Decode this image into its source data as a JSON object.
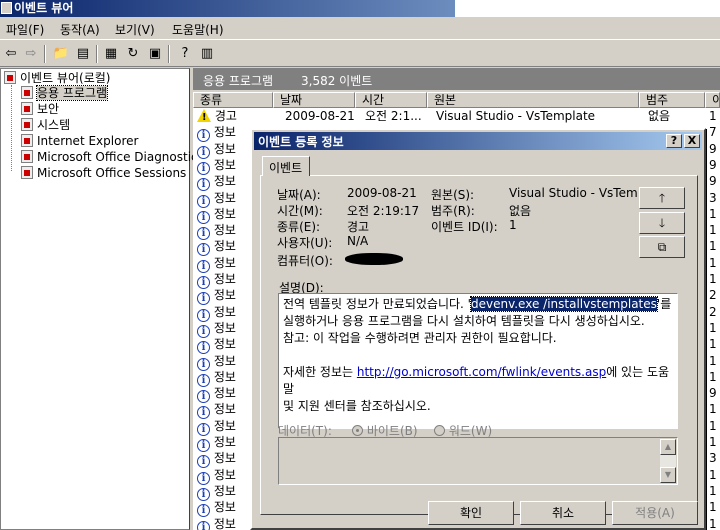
{
  "window": {
    "title": "이벤트 뷰어"
  },
  "menu": [
    "파일(F)",
    "동작(A)",
    "보기(V)",
    "도움말(H)"
  ],
  "toolbar_icons": [
    "back-arrow-icon",
    "forward-arrow-icon",
    "up-folder-icon",
    "show-hide-tree-icon",
    "properties-icon",
    "refresh-icon",
    "export-icon",
    "help-icon",
    "console-icon"
  ],
  "tree": {
    "root": "이벤트 뷰어(로컬)",
    "items": [
      "응용 프로그램",
      "보안",
      "시스템",
      "Internet Explorer",
      "Microsoft Office Diagnostic:",
      "Microsoft Office Sessions"
    ]
  },
  "pane": {
    "title": "응용 프로그램",
    "count": "3,582 이벤트"
  },
  "columns": [
    "종류",
    "날짜",
    "시간",
    "원본",
    "범주",
    "이"
  ],
  "rows": [
    {
      "type": "경고",
      "date": "2009-08-21",
      "time": "오전 2:1...",
      "source": "Visual Studio - VsTemplate",
      "category": "없음",
      "id": "1"
    },
    {
      "type": "정보",
      "date": "",
      "time": "",
      "source": "",
      "category": "",
      "id": "7"
    },
    {
      "type": "정보",
      "date": "",
      "time": "",
      "source": "",
      "category": "",
      "id": "9"
    },
    {
      "type": "정보",
      "date": "",
      "time": "",
      "source": "",
      "category": "",
      "id": "9"
    },
    {
      "type": "정보",
      "date": "",
      "time": "",
      "source": "",
      "category": "",
      "id": "9"
    },
    {
      "type": "정보",
      "date": "",
      "time": "",
      "source": "",
      "category": "",
      "id": "3"
    },
    {
      "type": "정보",
      "date": "",
      "time": "",
      "source": "",
      "category": "",
      "id": "1"
    },
    {
      "type": "정보",
      "date": "",
      "time": "",
      "source": "",
      "category": "",
      "id": "1"
    },
    {
      "type": "정보",
      "date": "",
      "time": "",
      "source": "",
      "category": "",
      "id": "1"
    },
    {
      "type": "정보",
      "date": "",
      "time": "",
      "source": "",
      "category": "",
      "id": "1"
    },
    {
      "type": "정보",
      "date": "",
      "time": "",
      "source": "",
      "category": "",
      "id": "1"
    },
    {
      "type": "정보",
      "date": "",
      "time": "",
      "source": "",
      "category": "",
      "id": "2"
    },
    {
      "type": "정보",
      "date": "",
      "time": "",
      "source": "",
      "category": "",
      "id": "2"
    },
    {
      "type": "정보",
      "date": "",
      "time": "",
      "source": "",
      "category": "",
      "id": "1"
    },
    {
      "type": "정보",
      "date": "",
      "time": "",
      "source": "",
      "category": "",
      "id": "1"
    },
    {
      "type": "정보",
      "date": "",
      "time": "",
      "source": "",
      "category": "",
      "id": "1"
    },
    {
      "type": "정보",
      "date": "",
      "time": "",
      "source": "",
      "category": "",
      "id": "1"
    },
    {
      "type": "정보",
      "date": "",
      "time": "",
      "source": "",
      "category": "",
      "id": "9"
    },
    {
      "type": "정보",
      "date": "",
      "time": "",
      "source": "",
      "category": "",
      "id": "1"
    },
    {
      "type": "정보",
      "date": "",
      "time": "",
      "source": "",
      "category": "",
      "id": "1"
    },
    {
      "type": "정보",
      "date": "",
      "time": "",
      "source": "",
      "category": "",
      "id": "1"
    },
    {
      "type": "정보",
      "date": "",
      "time": "",
      "source": "",
      "category": "",
      "id": "3"
    },
    {
      "type": "정보",
      "date": "",
      "time": "",
      "source": "",
      "category": "",
      "id": "1"
    },
    {
      "type": "정보",
      "date": "",
      "time": "",
      "source": "",
      "category": "",
      "id": "1"
    },
    {
      "type": "정보",
      "date": "",
      "time": "",
      "source": "",
      "category": "",
      "id": "1"
    },
    {
      "type": "정보",
      "date": "",
      "time": "",
      "source": "",
      "category": "",
      "id": "1"
    }
  ],
  "dialog": {
    "title": "이벤트 등록 정보",
    "tab": "이벤트",
    "help_btn": "?",
    "close_btn": "X",
    "date_label": "날짜(A):",
    "date_value": "2009-08-21",
    "time_label": "시간(M):",
    "time_value": "오전 2:19:17",
    "type_label": "종류(E):",
    "type_value": "경고",
    "user_label": "사용자(U):",
    "user_value": "N/A",
    "computer_label": "컴퓨터(O):",
    "source_label": "원본(S):",
    "source_value": "Visual Studio - VsTem",
    "category_label": "범주(R):",
    "category_value": "없음",
    "eventid_label": "이벤트 ID(I):",
    "eventid_value": "1",
    "desc_label": "설명(D):",
    "desc_line1_pre": "전역 템플릿 정보가 만료되었습니다. '",
    "desc_line1_hl": "devenv.exe /installvstemplates",
    "desc_line1_post": "'를",
    "desc_line2": "실행하거나 응용 프로그램을 다시 설치하여 템플릿을 다시 생성하십시오.",
    "desc_line3": "참고: 이 작업을 수행하려면 관리자 권한이 필요합니다.",
    "desc_line4_pre": "자세한 정보는 ",
    "desc_link": "http://go.microsoft.com/fwlink/events.asp",
    "desc_line4_post": "에 있는 도움말",
    "desc_line5": "및 지원 센터를 참조하십시오.",
    "data_label": "데이터(T):",
    "radio_bytes": "바이트(B)",
    "radio_words": "워드(W)",
    "ok": "확인",
    "cancel": "취소",
    "apply": "적용(A)"
  }
}
